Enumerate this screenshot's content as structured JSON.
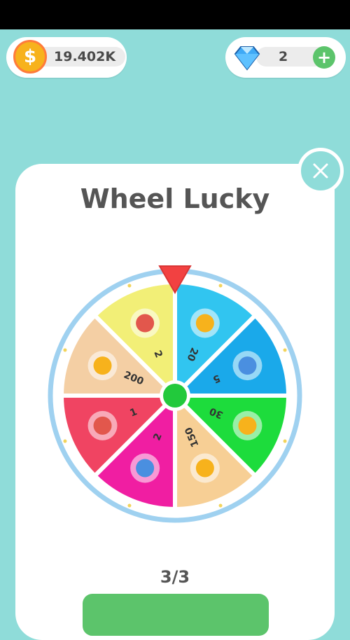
{
  "header": {
    "coins": {
      "value": "19.402K",
      "symbol": "$"
    },
    "gems": {
      "value": "2",
      "add_label": "+"
    }
  },
  "dialog": {
    "title": "Wheel Lucky",
    "spins_left": "3/3"
  },
  "wheel": {
    "segments": [
      {
        "label": "20",
        "reward": "coins",
        "color": "#31c5f0"
      },
      {
        "label": "5",
        "reward": "gems",
        "color": "#1aa9ea"
      },
      {
        "label": "30",
        "reward": "coins",
        "color": "#1ddc3c"
      },
      {
        "label": "150",
        "reward": "speed-boost",
        "color": "#f7cf95"
      },
      {
        "label": "2",
        "reward": "gem",
        "color": "#f01ea2"
      },
      {
        "label": "1",
        "reward": "chest",
        "color": "#f04462"
      },
      {
        "label": "200",
        "reward": "speed-boost",
        "color": "#f4cfa4"
      },
      {
        "label": "2",
        "reward": "chest",
        "color": "#f2ef77"
      }
    ],
    "pointer_color": "#f24141",
    "hub_color": "#22c93c",
    "rim_color": "#9fd1f0"
  },
  "colors": {
    "background": "#8fdcd9",
    "accent_green": "#5cc46b"
  }
}
